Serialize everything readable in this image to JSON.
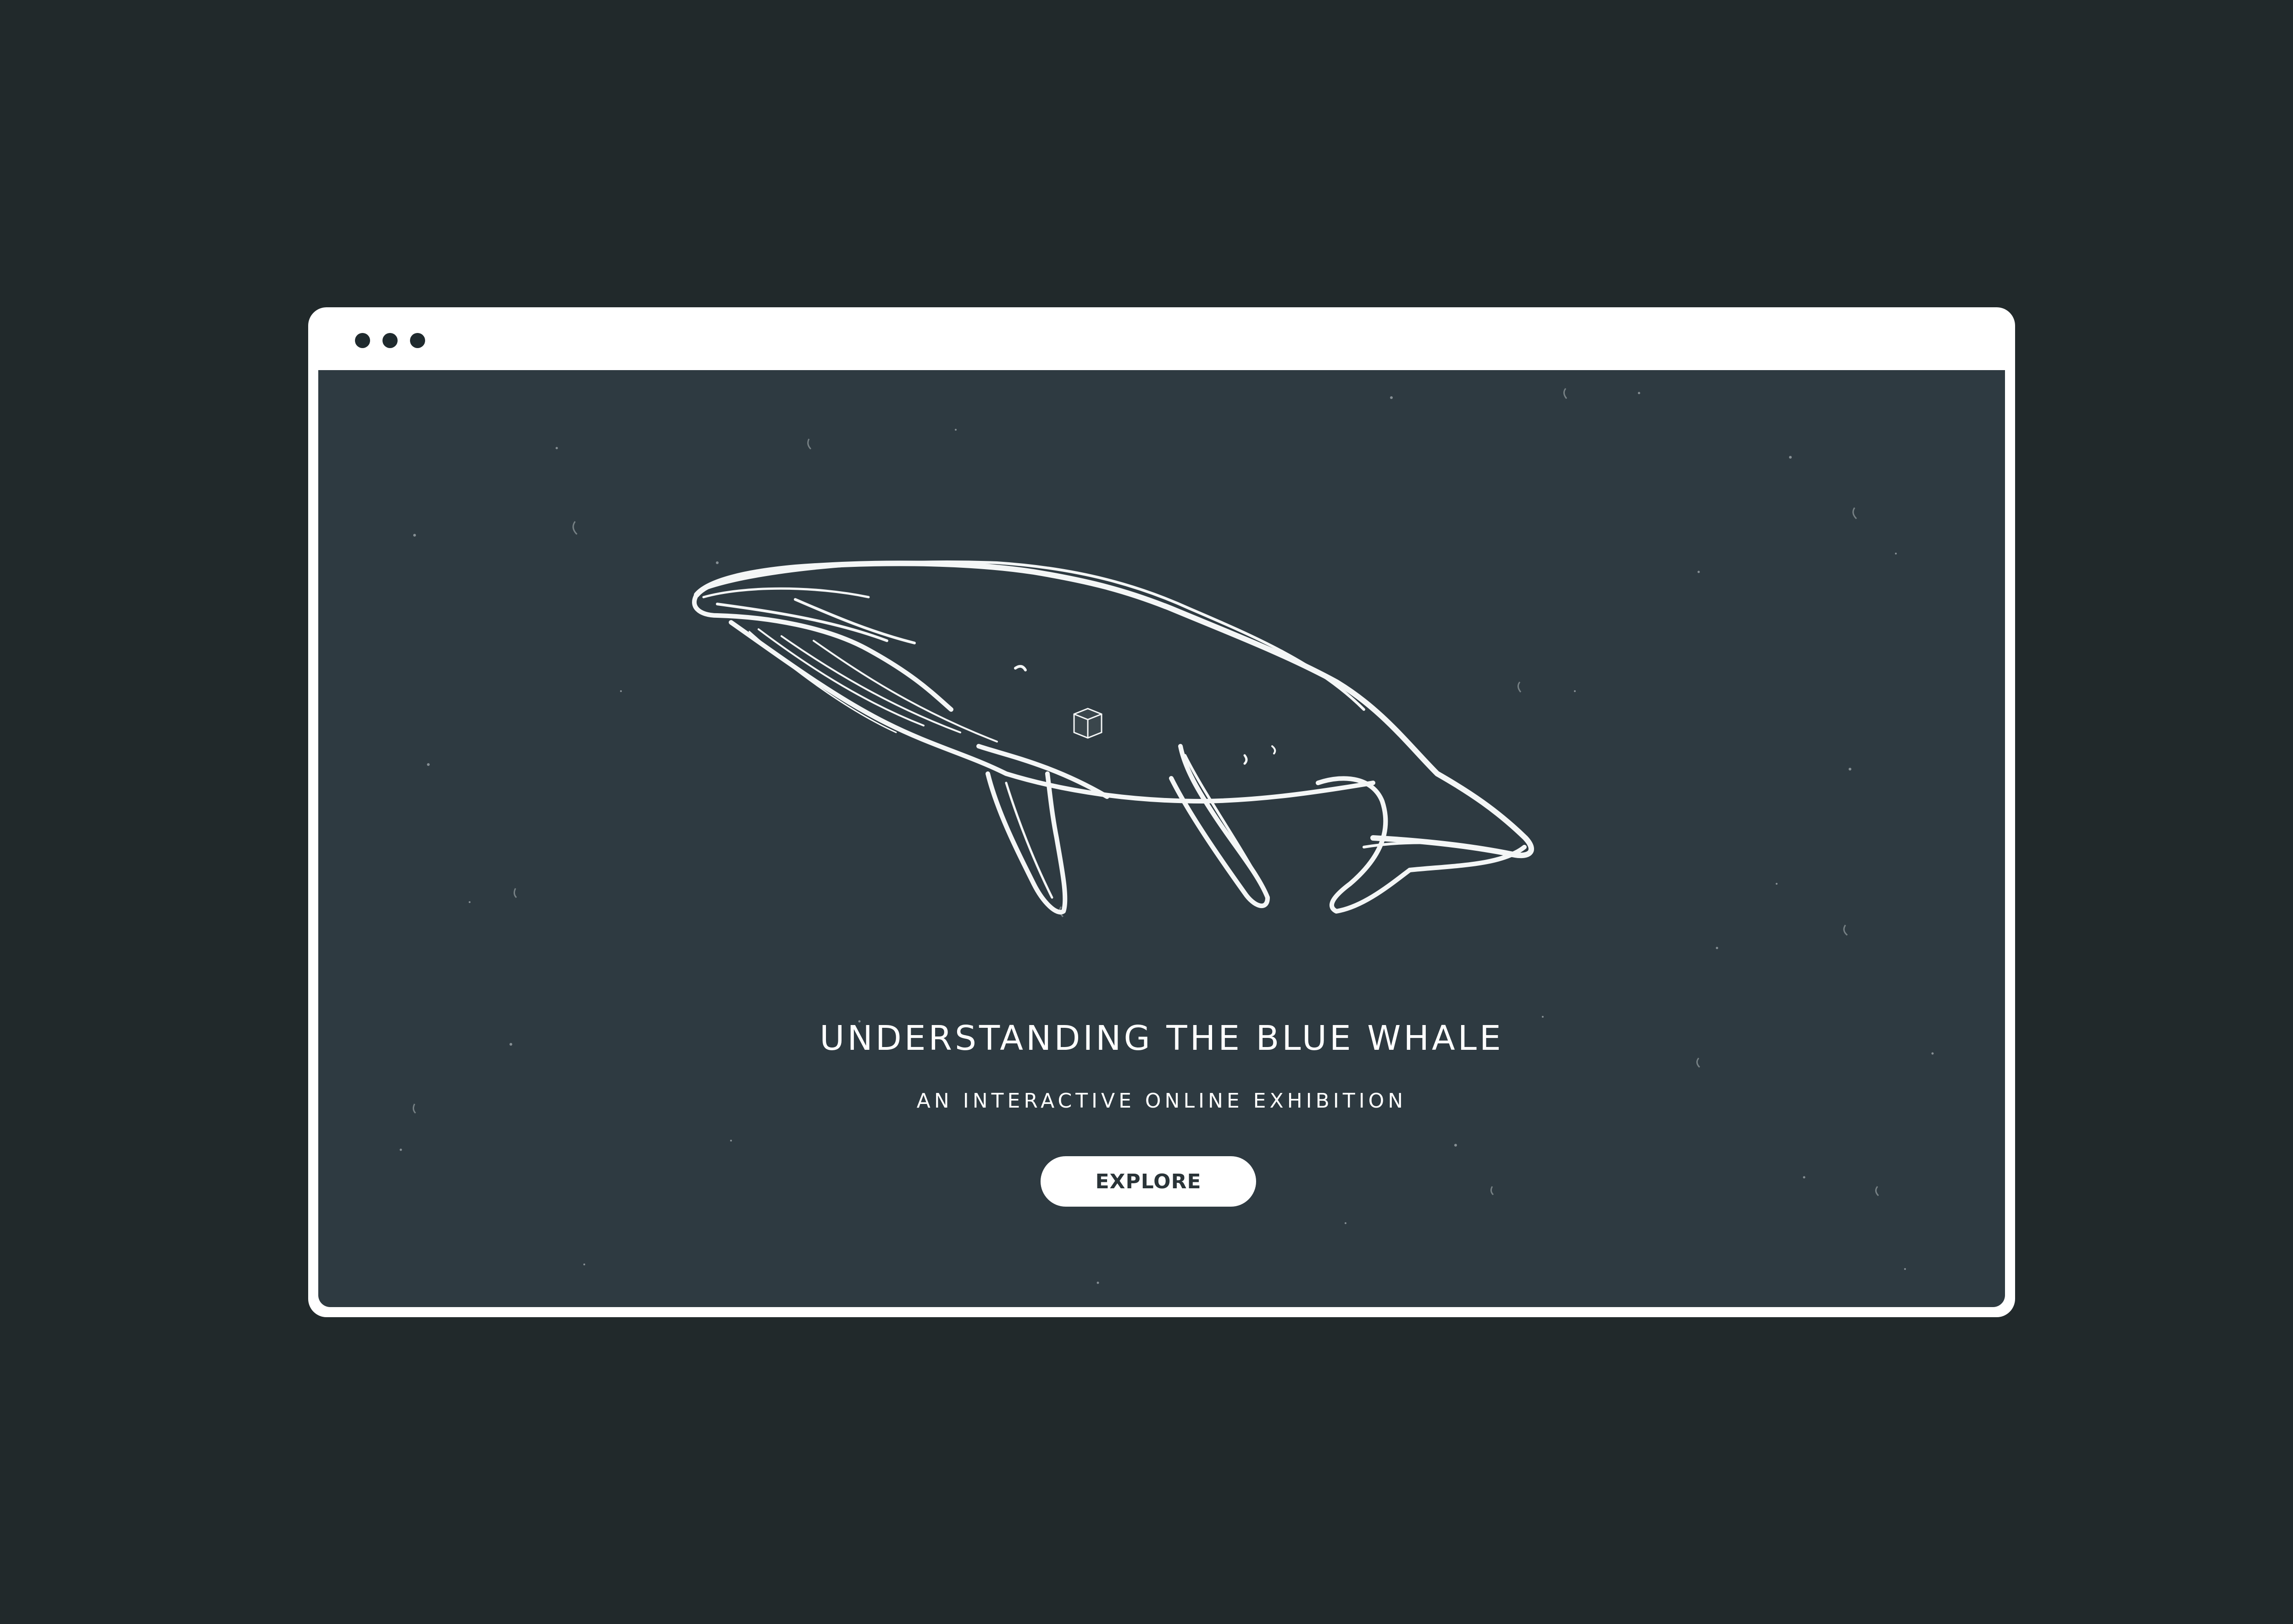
{
  "page": {
    "background_color": "#21292b"
  },
  "browser": {
    "frame_color": "#ffffff",
    "window_controls": [
      "dot",
      "dot",
      "dot"
    ],
    "viewport_color": "#2e3a41"
  },
  "hero": {
    "illustration": "blue-whale-sketch",
    "title": "UNDERSTANDING THE BLUE WHALE",
    "subtitle": "AN INTERACTIVE ONLINE EXHIBITION",
    "cta_label": "EXPLORE"
  }
}
